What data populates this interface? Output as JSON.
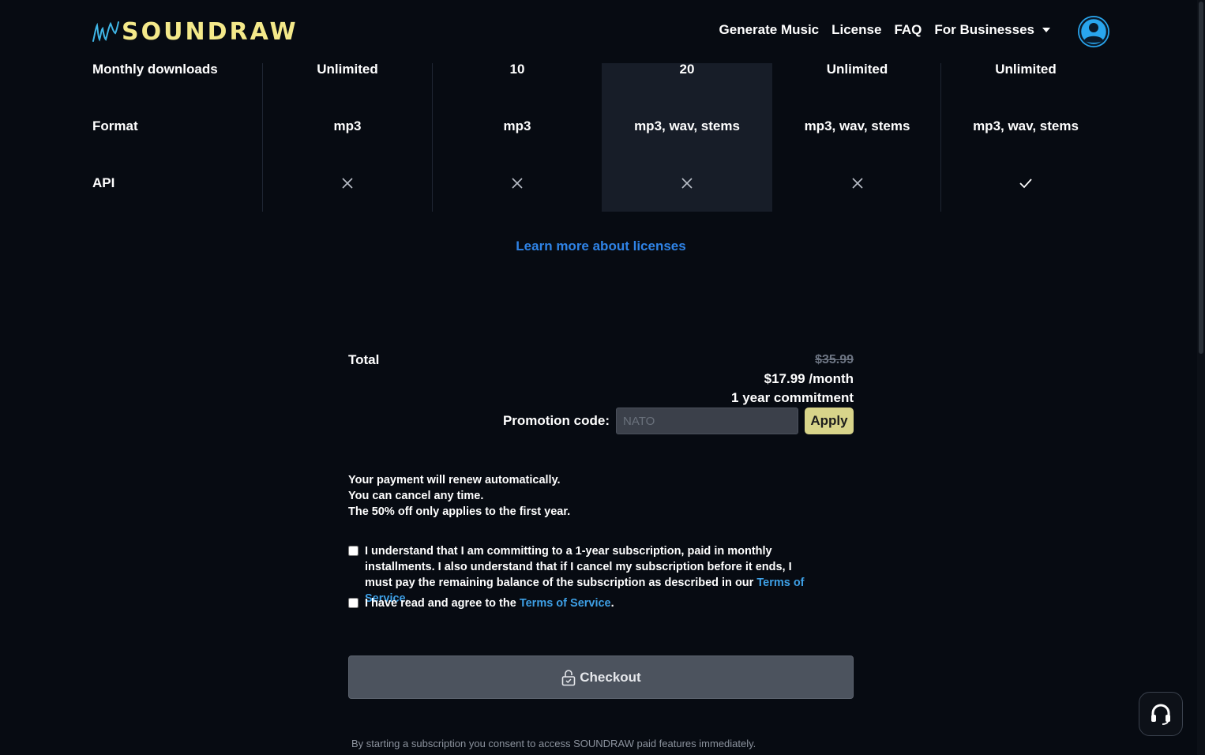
{
  "header": {
    "logo_text": "SOUNDRAW",
    "nav": {
      "generate_music": "Generate Music",
      "license": "License",
      "faq": "FAQ",
      "for_businesses": "For Businesses"
    }
  },
  "table": {
    "rows": [
      {
        "label": "Monthly downloads",
        "values": [
          "Unlimited",
          "10",
          "20",
          "Unlimited",
          "Unlimited"
        ]
      },
      {
        "label": "Format",
        "values": [
          "mp3",
          "mp3",
          "mp3, wav, stems",
          "mp3, wav, stems",
          "mp3, wav, stems"
        ]
      },
      {
        "label": "API",
        "values": [
          "x-icon",
          "x-icon",
          "x-icon",
          "x-icon",
          "check-icon"
        ]
      }
    ],
    "highlighted_column": 2
  },
  "learn_more": "Learn more about licenses",
  "total": {
    "label": "Total",
    "original_price": "$35.99",
    "price": "$17.99 /month",
    "commitment": "1 year commitment"
  },
  "promo": {
    "label": "Promotion code:",
    "value": "",
    "placeholder": "NATO",
    "apply_label": "Apply"
  },
  "notes": {
    "line1": "Your payment will renew automatically.",
    "line2": "You can cancel any time.",
    "line3": "The 50% off only applies to the first year."
  },
  "agreements": {
    "commit_text": "I understand that I am committing to a 1-year subscription, paid in monthly installments. I also understand that if I cancel my subscription before it ends, I must pay the remaining balance of the subscription as described in our",
    "commit_link": "Terms of Service",
    "tos_text": "I have read and agree to the",
    "tos_link": "Terms of Service",
    "period": "."
  },
  "checkout_label": "Checkout",
  "consent": "By starting a subscription you consent to access SOUNDRAW paid features immediately.",
  "colors": {
    "background": "#070b12",
    "logo": "#f4e98a",
    "link": "#2f83e6",
    "avatar": "#29a6ee",
    "apply": "#d8d48a",
    "highlight_column": "#171d28"
  }
}
